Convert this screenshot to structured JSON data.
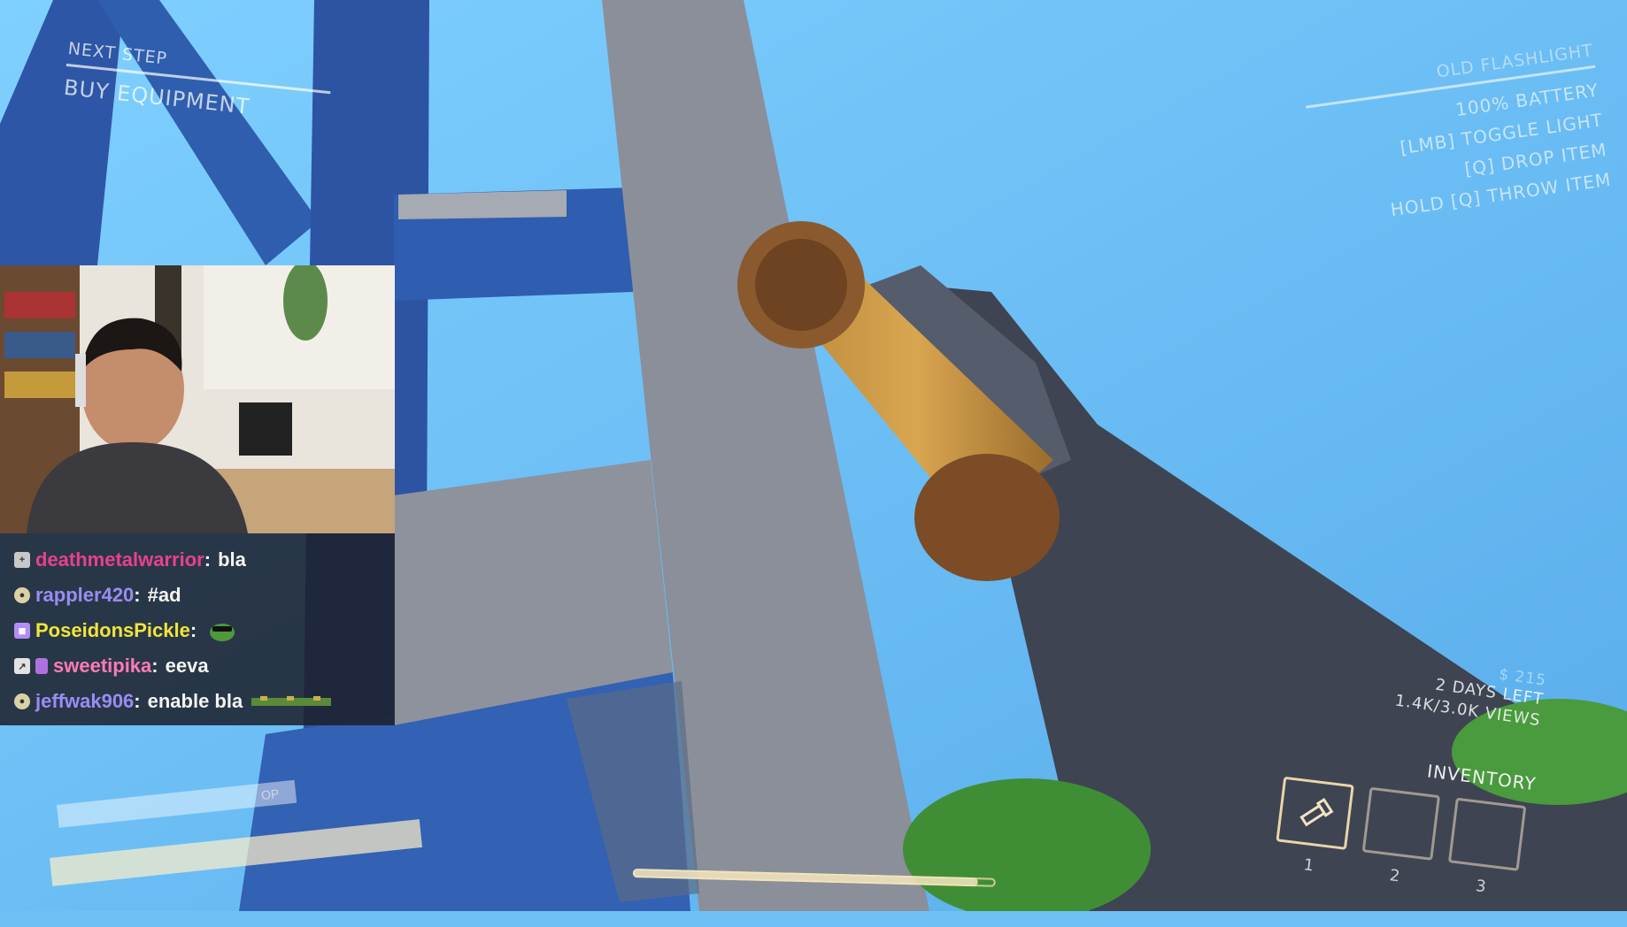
{
  "hud": {
    "objective": {
      "label": "NEXT STEP",
      "task": "BUY EQUIPMENT"
    },
    "item": {
      "name": "OLD FLASHLIGHT",
      "lines": [
        "100% BATTERY",
        "[LMB] TOGGLE LIGHT",
        "[Q] DROP ITEM",
        "HOLD [Q] THROW ITEM"
      ]
    },
    "status": {
      "money": "$ 215",
      "days": "2 DAYS LEFT",
      "views": "1.4K/3.0K VIEWS"
    },
    "inventory": {
      "label": "INVENTORY",
      "slots": [
        {
          "number": "1",
          "icon": "flashlight-icon",
          "selected": true
        },
        {
          "number": "2",
          "icon": "",
          "selected": false
        },
        {
          "number": "3",
          "icon": "",
          "selected": false
        }
      ]
    },
    "stamina_fraction": 0.95,
    "small_tag": "OP"
  },
  "chat": {
    "messages": [
      {
        "user": "deathmetalwarrior",
        "color": "#e8408c",
        "text": "bla",
        "badge": "plus-badge-icon"
      },
      {
        "user": "rappler420",
        "color": "#9a8cf4",
        "text": "#ad",
        "badge": "coin-badge-icon"
      },
      {
        "user": "PoseidonsPickle",
        "color": "#f2e43a",
        "text": "",
        "badge": "calendar-badge-icon",
        "emote": "frog-emote-icon"
      },
      {
        "user": "sweetipika",
        "color": "#ff7ab5",
        "text": "eeva",
        "badge": "chart-badge-icon"
      },
      {
        "user": "jeffwak906",
        "color": "#9a8cf4",
        "text": "enable bla",
        "badge": "coin-badge-icon",
        "emote": "emote-strip-icon"
      }
    ]
  },
  "colors": {
    "sky": "#6fc0f5",
    "structure": "#2e5aa8",
    "concrete": "#8a8f9a",
    "hud_text": "#ffffff",
    "inventory_border": "#e9d6a8"
  }
}
